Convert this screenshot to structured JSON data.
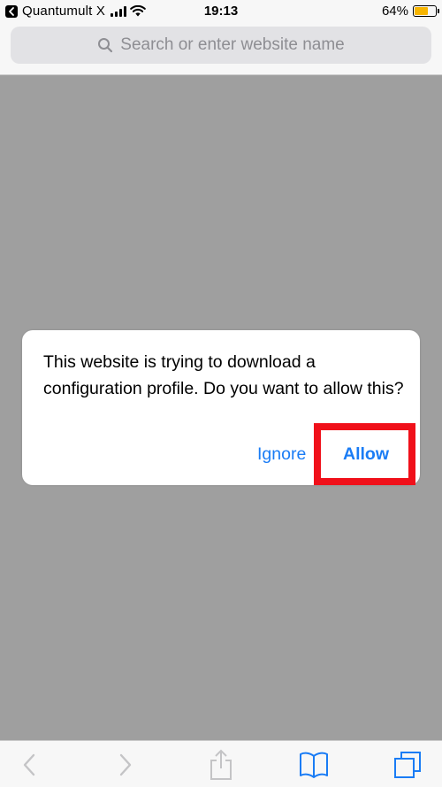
{
  "status_bar": {
    "carrier": "Quantumult X",
    "time": "19:13",
    "battery": "64%",
    "battery_level": 0.64,
    "battery_color": "#f7b500"
  },
  "address_bar": {
    "placeholder": "Search or enter website name",
    "icon": "search-icon"
  },
  "alert": {
    "message": "This website is trying to download a configuration profile. Do you want to allow this?",
    "ignore_label": "Ignore",
    "allow_label": "Allow",
    "button_color": "#1a7cf5",
    "highlight_color": "#f0101a"
  },
  "toolbar": {
    "icons": [
      "back-chevron-icon",
      "forward-chevron-icon",
      "share-icon",
      "bookmarks-icon",
      "tabs-icon"
    ],
    "active_color": "#1a7cf5",
    "disabled_color": "#c4c4c6"
  }
}
